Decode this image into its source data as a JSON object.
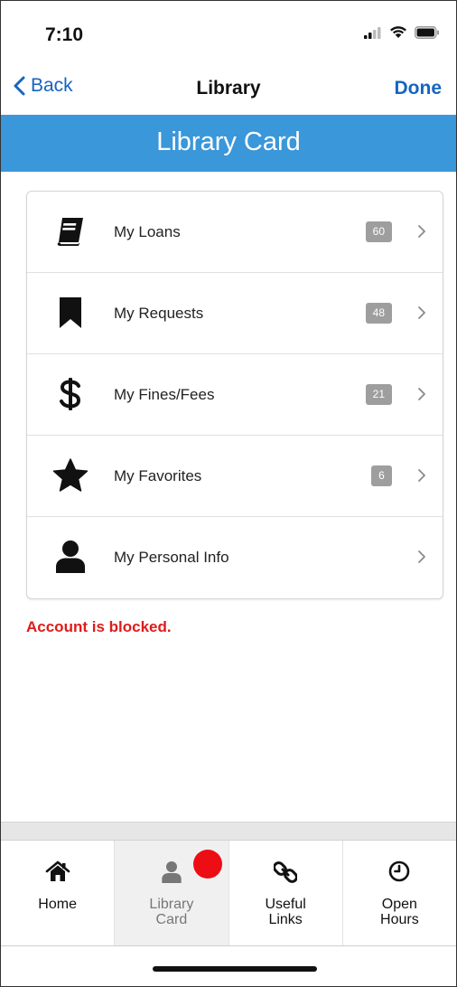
{
  "status_bar": {
    "time": "7:10"
  },
  "nav": {
    "back_label": "Back",
    "title": "Library",
    "done_label": "Done"
  },
  "banner": {
    "title": "Library Card"
  },
  "menu": {
    "items": [
      {
        "label": "My Loans",
        "badge": "60",
        "icon": "book-icon"
      },
      {
        "label": "My Requests",
        "badge": "48",
        "icon": "bookmark-icon"
      },
      {
        "label": "My Fines/Fees",
        "badge": "21",
        "icon": "dollar-icon"
      },
      {
        "label": "My Favorites",
        "badge": "6",
        "icon": "star-icon"
      },
      {
        "label": "My Personal Info",
        "badge": "",
        "icon": "user-icon"
      }
    ]
  },
  "alert": {
    "text": "Account is blocked.",
    "color": "#e01b1b"
  },
  "tabs": [
    {
      "label_line1": "Home",
      "label_line2": "",
      "icon": "home-icon"
    },
    {
      "label_line1": "Library",
      "label_line2": "Card",
      "icon": "user-icon",
      "active": true
    },
    {
      "label_line1": "Useful",
      "label_line2": "Links",
      "icon": "link-icon"
    },
    {
      "label_line1": "Open",
      "label_line2": "Hours",
      "icon": "clock-icon"
    }
  ],
  "colors": {
    "accent": "#1565c0",
    "banner": "#3a97d9",
    "badge": "#9e9e9e",
    "notification": "#ee0d14"
  }
}
